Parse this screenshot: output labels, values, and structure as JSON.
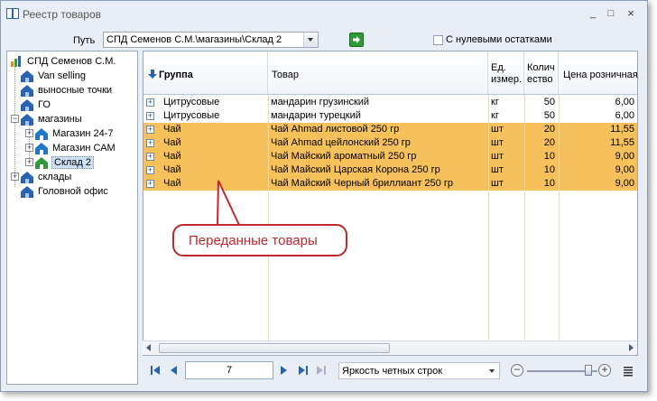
{
  "window": {
    "title": "Реестр товаров",
    "controls": [
      "_",
      "□",
      "×"
    ]
  },
  "toolbar": {
    "path_label": "Путь",
    "path_value": "СПД Семенов С.М.\\магазины\\Склад 2",
    "zero_balance_label": "С нулевыми остатками",
    "zero_balance_checked": false
  },
  "tree": {
    "root": "СПД Семенов С.М.",
    "nodes": [
      {
        "label": "Van selling"
      },
      {
        "label": "выносные точки"
      },
      {
        "label": "ГО"
      },
      {
        "label": "магазины"
      },
      {
        "label": "Магазин 24-7"
      },
      {
        "label": "Магазин САМ"
      },
      {
        "label": "Склад 2"
      },
      {
        "label": "склады"
      },
      {
        "label": "Головной офис"
      }
    ],
    "expander_plus": "+",
    "expander_minus": "−"
  },
  "grid": {
    "columns": {
      "group": "Группа",
      "product": "Товар",
      "unit": "Ед. измер.",
      "qty": "Количество",
      "price": "Цена розничная"
    },
    "rows": [
      {
        "group": "Цитрусовые",
        "product": "мандарин грузинский",
        "unit": "кг",
        "qty": "50",
        "price": "6,00",
        "highlight": false
      },
      {
        "group": "Цитрусовые",
        "product": "мандарин турецкий",
        "unit": "кг",
        "qty": "50",
        "price": "6,00",
        "highlight": false
      },
      {
        "group": "Чай",
        "product": "Чай Ahmad листовой 250 гр",
        "unit": "шт",
        "qty": "20",
        "price": "11,55",
        "highlight": true
      },
      {
        "group": "Чай",
        "product": "Чай Ahmad цейлонский 250 гр",
        "unit": "шт",
        "qty": "20",
        "price": "11,55",
        "highlight": true
      },
      {
        "group": "Чай",
        "product": "Чай Майский ароматный 250 гр",
        "unit": "шт",
        "qty": "10",
        "price": "9,00",
        "highlight": true
      },
      {
        "group": "Чай",
        "product": "Чай Майский Царская Корона 250 гр",
        "unit": "шт",
        "qty": "10",
        "price": "9,00",
        "highlight": true
      },
      {
        "group": "Чай",
        "product": "Чай Майский Черный бриллиант 250 гр",
        "unit": "шт",
        "qty": "10",
        "price": "9,00",
        "highlight": true
      }
    ]
  },
  "callout": {
    "text": "Переданные товары"
  },
  "navigator": {
    "page": "7",
    "brightness_option": "Яркость четных строк",
    "zoom_minus": "−",
    "zoom_plus": "+"
  },
  "colors": {
    "highlight_row": "#f6c05a",
    "callout_red": "#c1272d",
    "window_bg": "#e9eef6"
  }
}
